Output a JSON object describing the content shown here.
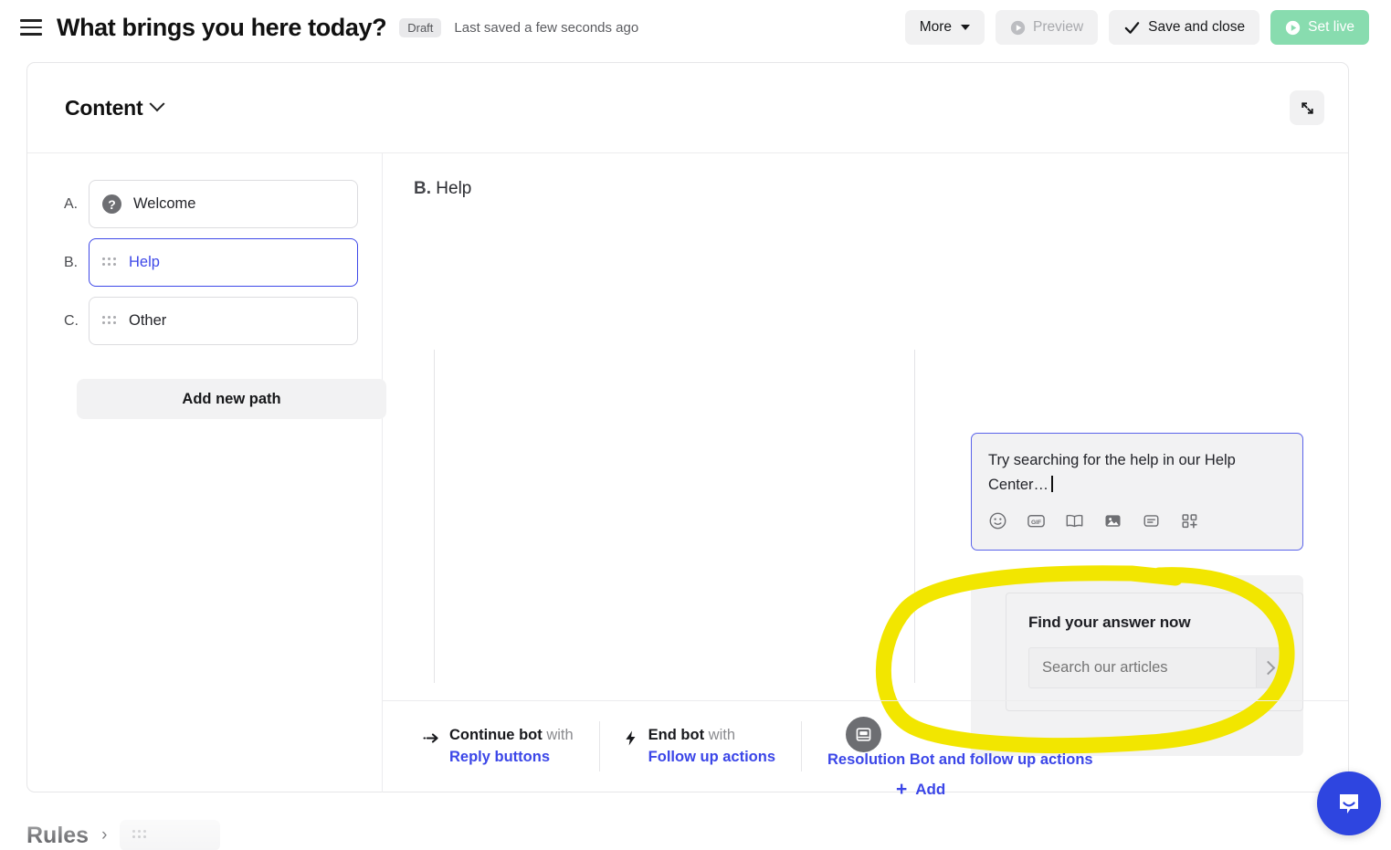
{
  "topbar": {
    "menu_icon": "hamburger-icon",
    "title": "What brings you here today?",
    "status_badge": "Draft",
    "saved_text": "Last saved a few seconds ago",
    "buttons": {
      "more": "More",
      "preview": "Preview",
      "save_and_close": "Save and close",
      "set_live": "Set live"
    },
    "colors": {
      "primary_green": "#88dcaf",
      "link_blue": "#3b46e8"
    }
  },
  "content_panel": {
    "title": "Content",
    "expand_icon": "expand-diagonal-icon",
    "paths": [
      {
        "letter": "A.",
        "label": "Welcome",
        "icon": "question-circle-icon",
        "selected": false
      },
      {
        "letter": "B.",
        "label": "Help",
        "icon": "drag-handle-icon",
        "selected": true
      },
      {
        "letter": "C.",
        "label": "Other",
        "icon": "drag-handle-icon",
        "selected": false
      }
    ],
    "add_new_path": "Add new path"
  },
  "editor": {
    "heading_letter": "B.",
    "heading_label": "Help",
    "composer": {
      "message": "Try searching for the help in our Help Center…",
      "tools": [
        "emoji-icon",
        "gif-icon",
        "article-book-icon",
        "image-icon",
        "card-icon",
        "apps-plus-icon"
      ]
    },
    "answer_card": {
      "title": "Find your answer now",
      "search_placeholder": "Search our articles",
      "submit_icon": "chevron-right-icon",
      "avatar_icon": "bot-avatar-icon"
    },
    "add_block": {
      "plus": "+",
      "label": "Add"
    },
    "annotation": {
      "type": "highlight-circle",
      "color": "#f2e600"
    }
  },
  "footer": {
    "continue": {
      "icon": "arrow-right-icon",
      "prefix": "Continue bot",
      "suffix": "with",
      "link": "Reply buttons"
    },
    "end": {
      "icon": "lightning-icon",
      "prefix": "End bot",
      "suffix": "with",
      "link": "Follow up actions"
    },
    "extra_link": "Resolution Bot and follow up actions"
  },
  "below": {
    "rules_title": "Rules",
    "rules_chevron": "›"
  },
  "launcher": {
    "icon": "intercom-messenger-icon",
    "color": "#2e45e0"
  }
}
